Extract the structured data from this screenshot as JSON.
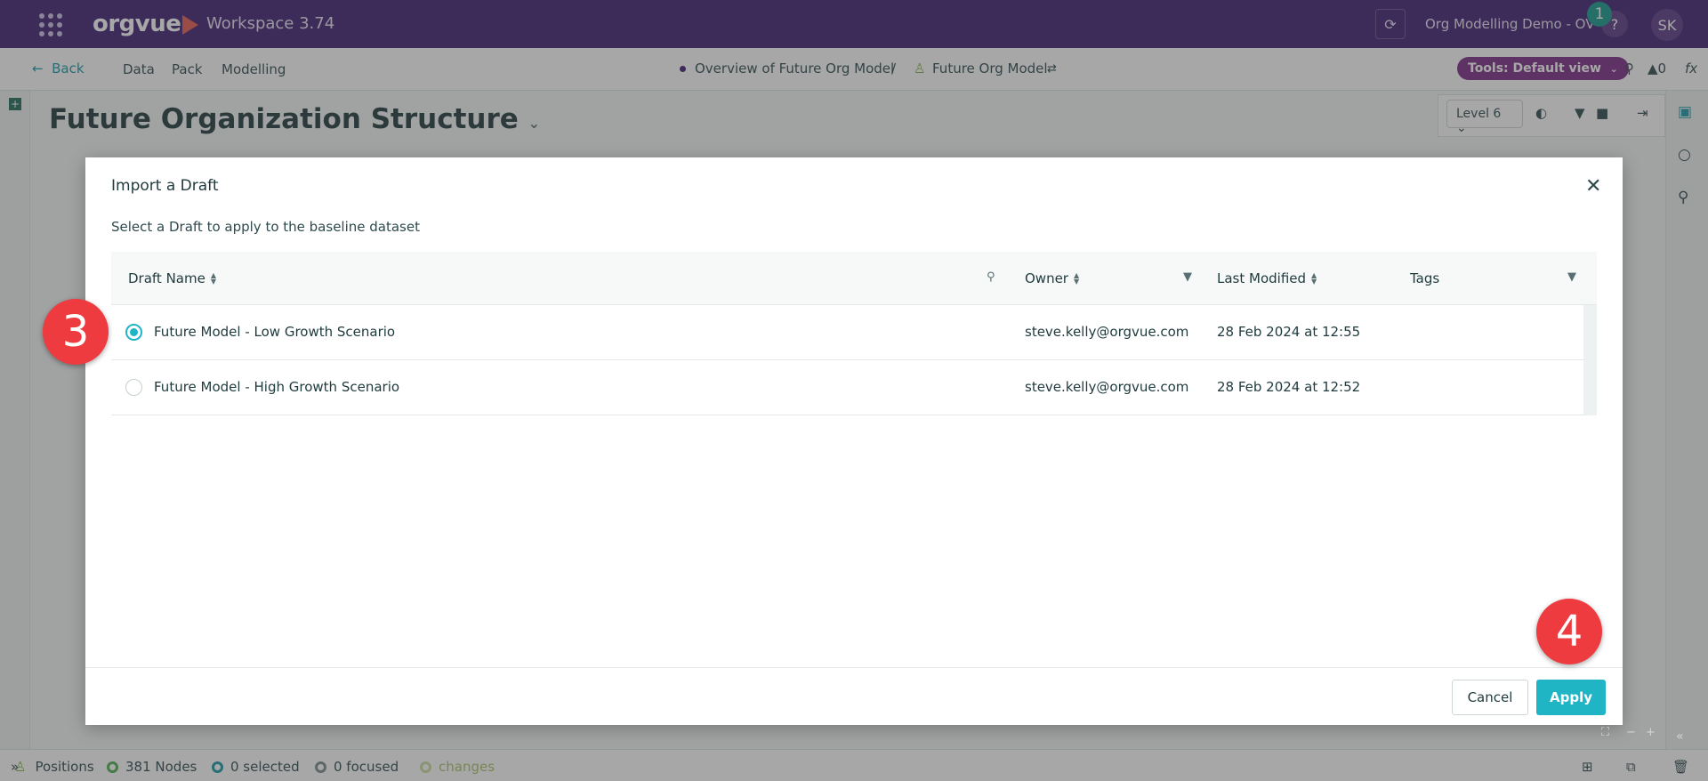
{
  "topbar": {
    "logo": "orgvue",
    "workspace": "Workspace  3.74",
    "project": "Org Modelling Demo - OV",
    "notification_count": "1",
    "help": "?",
    "avatar": "SK"
  },
  "navbar": {
    "back": "Back",
    "items": [
      "Data",
      "Pack",
      "Modelling"
    ],
    "breadcrumb": [
      "Overview of Future Org Model",
      "/",
      "Future Org Model"
    ],
    "tools_label": "Tools: Default view",
    "alerts_count": "0",
    "fx": "fx"
  },
  "page": {
    "title": "Future Organization Structure",
    "level": "Level 6"
  },
  "statusbar": {
    "positions": "Positions",
    "nodes": "381 Nodes",
    "selected": "0 selected",
    "focused": "0 focused",
    "changes": "changes"
  },
  "modal": {
    "title": "Import a Draft",
    "subtitle": "Select a Draft to apply to the baseline dataset",
    "columns": {
      "draft_name": "Draft Name",
      "owner": "Owner",
      "last_modified": "Last Modified",
      "tags": "Tags"
    },
    "rows": [
      {
        "name": "Future Model - Low Growth Scenario",
        "owner": "steve.kelly@orgvue.com",
        "modified": "28 Feb 2024 at 12:55",
        "tags": "",
        "selected": true
      },
      {
        "name": "Future Model - High Growth Scenario",
        "owner": "steve.kelly@orgvue.com",
        "modified": "28 Feb 2024 at 12:52",
        "tags": "",
        "selected": false
      }
    ],
    "cancel": "Cancel",
    "apply": "Apply"
  },
  "steps": {
    "step3": "3",
    "step4": "4"
  },
  "colors": {
    "topbar": "#3f1e72",
    "accent": "#1fb5c5",
    "tools_pill": "#7b2a86",
    "step_marker": "#ee3b3f"
  }
}
